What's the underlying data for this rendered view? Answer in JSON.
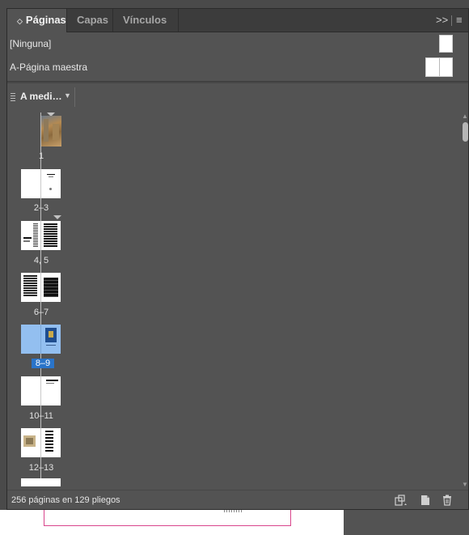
{
  "tabs": [
    {
      "label": "Páginas",
      "active": true
    },
    {
      "label": "Capas",
      "active": false
    },
    {
      "label": "Vínculos",
      "active": false
    }
  ],
  "toolbar_icons": {
    "collapse": "double-chevron-right-icon",
    "menu": "panel-menu-icon"
  },
  "masters": [
    {
      "label": "[Ninguna]",
      "thumb": "single"
    },
    {
      "label": "A-Página maestra",
      "thumb": "spread"
    }
  ],
  "view": {
    "label": "A medi…"
  },
  "pages": [
    {
      "label": "1",
      "selected": false
    },
    {
      "label": "2–3",
      "selected": false
    },
    {
      "label": "4, 5",
      "selected": false
    },
    {
      "label": "6–7",
      "selected": false
    },
    {
      "label": "8–9",
      "selected": true
    },
    {
      "label": "10–11",
      "selected": false
    },
    {
      "label": "12–13",
      "selected": false
    }
  ],
  "footer": {
    "status": "256 páginas en 129 pliegos",
    "icons": [
      "edit-page-size-icon",
      "new-page-icon",
      "trash-icon"
    ]
  },
  "colors": {
    "panel": "#535353",
    "selection": "#2a74c9",
    "selected_thumb": "#93bff0"
  }
}
